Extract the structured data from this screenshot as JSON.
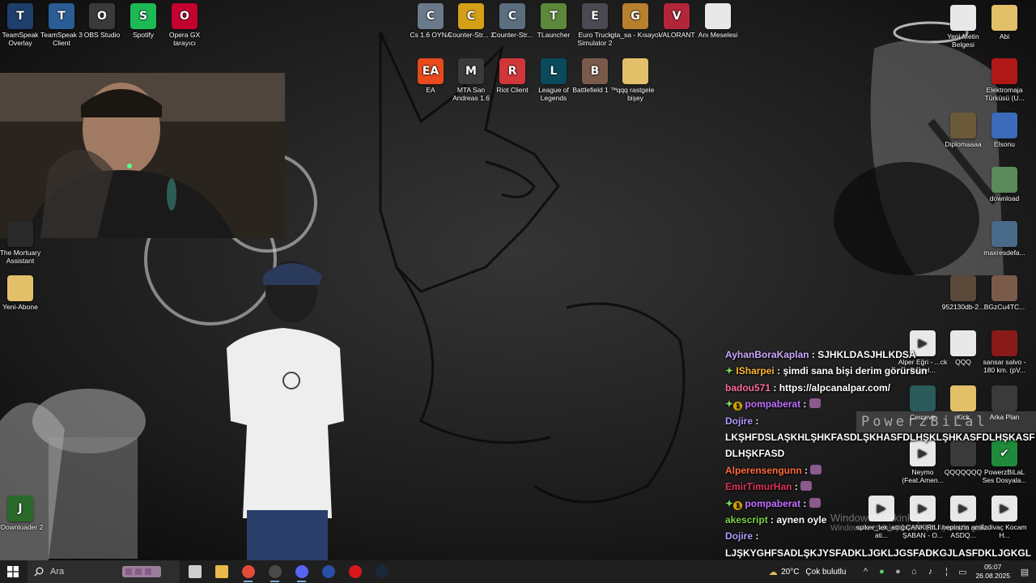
{
  "desktop": {
    "icons": [
      {
        "label": "TeamSpeak Overlay",
        "icon": "teamspeak-icon",
        "color": "#1e3f6b",
        "glyph": "T"
      },
      {
        "label": "TeamSpeak 3 Client",
        "icon": "teamspeak-icon",
        "color": "#2a5d96",
        "glyph": "T"
      },
      {
        "label": "OBS Studio",
        "icon": "obs-icon",
        "color": "#3a3a3a",
        "glyph": "O"
      },
      {
        "label": "Spotify",
        "icon": "spotify-icon",
        "color": "#1db954",
        "glyph": "S"
      },
      {
        "label": "Opera GX tarayıcı",
        "icon": "opera-gx-icon",
        "color": "#c40030",
        "glyph": "O"
      },
      {
        "label": "Cs 1.6 OYNA",
        "icon": "counter-strike-icon",
        "color": "#6a7a8a",
        "glyph": "C"
      },
      {
        "label": "Counter-Str... 2",
        "icon": "counter-strike-2-icon",
        "color": "#d4a017",
        "glyph": "C"
      },
      {
        "label": "Counter-Str...",
        "icon": "counter-strike-icon",
        "color": "#5b6e80",
        "glyph": "C"
      },
      {
        "label": "TLauncher",
        "icon": "minecraft-icon",
        "color": "#5c8a3a",
        "glyph": "T"
      },
      {
        "label": "Euro Truck Simulator 2",
        "icon": "truck-icon",
        "color": "#4a4a52",
        "glyph": "E"
      },
      {
        "label": "gta_sa - Kısayol",
        "icon": "gta-icon",
        "color": "#b8802e",
        "glyph": "G"
      },
      {
        "label": "VALORANT",
        "icon": "valorant-icon",
        "color": "#b3263a",
        "glyph": "V"
      },
      {
        "label": "Anı Meselesi",
        "icon": "text-file-icon",
        "color": "#e8e8e8",
        "glyph": ""
      },
      {
        "label": "EA",
        "icon": "ea-icon",
        "color": "#e84a1c",
        "glyph": "EA"
      },
      {
        "label": "MTA San Andreas 1.6",
        "icon": "mta-icon",
        "color": "#3a3a3a",
        "glyph": "M"
      },
      {
        "label": "Riot Client",
        "icon": "riot-icon",
        "color": "#d13639",
        "glyph": "R"
      },
      {
        "label": "League of Legends",
        "icon": "lol-icon",
        "color": "#0a4a5c",
        "glyph": "L"
      },
      {
        "label": "Battlefield 1 ™",
        "icon": "battlefield-icon",
        "color": "#7a5a4a",
        "glyph": "B"
      },
      {
        "label": "qqq rastgele bişey",
        "icon": "folder-icon",
        "color": "#e2c06a",
        "glyph": ""
      },
      {
        "label": "Yeni Metin Belgesi",
        "icon": "text-file-icon",
        "color": "#e8e8e8",
        "glyph": ""
      },
      {
        "label": "Abi",
        "icon": "folder-icon",
        "color": "#e2c06a",
        "glyph": ""
      },
      {
        "label": "Elektromaja Türküsü (U...",
        "icon": "media-icon",
        "color": "#b01818",
        "glyph": ""
      },
      {
        "label": "Diplomaaaa",
        "icon": "image-icon",
        "color": "#6a5a3a",
        "glyph": ""
      },
      {
        "label": "Elsonu",
        "icon": "audio-icon",
        "color": "#3a6ab8",
        "glyph": ""
      },
      {
        "label": "download",
        "icon": "image-icon",
        "color": "#5a8a5a",
        "glyph": ""
      },
      {
        "label": "maxresdefa...",
        "icon": "image-icon",
        "color": "#4a6a8a",
        "glyph": ""
      },
      {
        "label": "952130db-2...",
        "icon": "image-icon",
        "color": "#5a4a3a",
        "glyph": ""
      },
      {
        "label": "BGzCu4TC...",
        "icon": "image-icon",
        "color": "#7a5a4a",
        "glyph": ""
      },
      {
        "label": "Alper Eğri - ...ck Daniel...",
        "icon": "video-icon",
        "color": "#e8e8e8",
        "glyph": "▶"
      },
      {
        "label": "QQQ",
        "icon": "text-file-icon",
        "color": "#e8e8e8",
        "glyph": ""
      },
      {
        "label": "sansar salvo - 180 km. (pV...",
        "icon": "media-icon",
        "color": "#8a1a1a",
        "glyph": ""
      },
      {
        "label": "Cerceve",
        "icon": "image-icon",
        "color": "#2a5a5a",
        "glyph": ""
      },
      {
        "label": "Kick",
        "icon": "folder-icon",
        "color": "#e2c06a",
        "glyph": ""
      },
      {
        "label": "Arka Plan",
        "icon": "image-icon",
        "color": "#3a3a3a",
        "glyph": ""
      },
      {
        "label": "Neymo (Feat.Amen...",
        "icon": "video-icon",
        "color": "#e8e8e8",
        "glyph": "▶"
      },
      {
        "label": "QQQQQQQ",
        "icon": "image-icon",
        "color": "#3a3a3a",
        "glyph": ""
      },
      {
        "label": "PowerzBiLaL Ses Dosyala...",
        "icon": "checkmark-icon",
        "color": "#1f8a3a",
        "glyph": "✔"
      },
      {
        "label": "The Mortuary Assistant",
        "icon": "game-icon",
        "color": "#2a2a2a",
        "glyph": ""
      },
      {
        "label": "Yeni-Abone",
        "icon": "folder-icon",
        "color": "#e2c06a",
        "glyph": ""
      },
      {
        "label": "spiker_tek_attığı ati...",
        "icon": "video-icon",
        "color": "#e8e8e8",
        "glyph": "▶"
      },
      {
        "label": "ÇANKIRILI ŞABAN - O...",
        "icon": "video-icon",
        "color": "#e8e8e8",
        "glyph": "▶"
      },
      {
        "label": "hepinizin amk ASDQ...",
        "icon": "video-icon",
        "color": "#e8e8e8",
        "glyph": "▶"
      },
      {
        "label": "İzdivaç Kocam H...",
        "icon": "video-icon",
        "color": "#e8e8e8",
        "glyph": "▶"
      },
      {
        "label": "JDownloader 2",
        "icon": "jdownloader-icon",
        "color": "#2a6a2a",
        "glyph": "J"
      }
    ]
  },
  "chat": {
    "messages": [
      {
        "user": "AyhanBoraKaplan",
        "color": "#c9a9ff",
        "badge": "",
        "text": "SJHKLDASJHLKDSA"
      },
      {
        "user": "ISharpei",
        "color": "#ffb833",
        "badge": "sparkle",
        "text": "şimdi sana bişi derim görürsün"
      },
      {
        "user": "badou571",
        "color": "#ff6b9a",
        "badge": "",
        "text": "https://alpcanalpar.com/"
      },
      {
        "user": "pompaberat",
        "color": "#c070ff",
        "badge": "sub",
        "text": ""
      },
      {
        "user": "Dojire",
        "color": "#b49cff",
        "badge": "",
        "text": "LKŞHFDSLAŞKHLŞHKFASDLŞKHASFDLHŞKLŞHKASFDLHŞKASFDLHŞKFASD"
      },
      {
        "user": "Alperensengunn",
        "color": "#ff6a3d",
        "badge": "",
        "text": ""
      },
      {
        "user": "EmirTimurHan",
        "color": "#e0345a",
        "badge": "",
        "text": ""
      },
      {
        "user": "pompaberat",
        "color": "#c070ff",
        "badge": "sub",
        "text": ""
      },
      {
        "user": "akescript",
        "color": "#7fd14a",
        "badge": "",
        "text": "aynen oyle"
      },
      {
        "user": "Dojire",
        "color": "#b49cff",
        "badge": "",
        "text": "LJŞKYGHFSADLŞKJYSFADKLJGKLJGSFADKGJLASFDKLJGKGLJASFDKGJLASFDKGJLASFDKLGJASFD,"
      }
    ]
  },
  "overlay": {
    "powerz_text": "PowerzBiLal",
    "watermark_title": "Windows'u Etkinleştir",
    "watermark_sub": "Windows'u etkinleştirmek için Ayarlar'a gidin."
  },
  "taskbar": {
    "search_label": "Ara",
    "search_placeholder": "",
    "weather_temp": "20°C",
    "weather_text": "Çok bulutlu",
    "time": "05:07",
    "date": "26.08.2025",
    "apps": [
      {
        "name": "task-view-icon",
        "color": "#cfcfcf",
        "active": false
      },
      {
        "name": "file-explorer-icon",
        "color": "#e9b94a",
        "active": false
      },
      {
        "name": "chrome-icon",
        "color": "#e24b3a",
        "active": true
      },
      {
        "name": "obs-icon",
        "color": "#4a4a4a",
        "active": true
      },
      {
        "name": "discord-icon",
        "color": "#5865f2",
        "active": true
      },
      {
        "name": "browser-icon",
        "color": "#2a4fa8",
        "active": false
      },
      {
        "name": "youtube-icon",
        "color": "#d8161c",
        "active": false
      },
      {
        "name": "steam-icon",
        "color": "#1b2838",
        "active": false
      }
    ]
  }
}
